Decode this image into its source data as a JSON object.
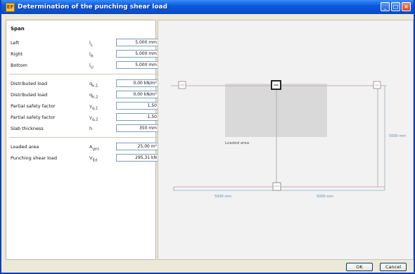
{
  "window": {
    "title": "Determination of the punching shear load",
    "app_icon": "EF"
  },
  "win_buttons": {
    "minimize": "_",
    "maximize": "□",
    "close": "×"
  },
  "span": {
    "title": "Span",
    "rows": [
      {
        "label": "Left",
        "symbol": "l",
        "sub": "L",
        "value": "5.000 mm"
      },
      {
        "label": "Right",
        "symbol": "l",
        "sub": "R",
        "value": "5.000 mm"
      },
      {
        "label": "Bottom",
        "symbol": "l",
        "sub": "U",
        "value": "5.000 mm"
      }
    ]
  },
  "loads": {
    "rows": [
      {
        "label": "Distributed load",
        "symbol": "q",
        "sub": "k,1",
        "value": "0,00 kN/m²"
      },
      {
        "label": "Distributed load",
        "symbol": "q",
        "sub": "k,2",
        "value": "0,00 kN/m²"
      },
      {
        "label": "Partial safety factor",
        "symbol": "γ",
        "sub": "q,1",
        "value": "1,50"
      },
      {
        "label": "Partial safety factor",
        "symbol": "γ",
        "sub": "q,2",
        "value": "1,50"
      },
      {
        "label": "Slab thickness",
        "symbol": "h",
        "sub": "",
        "value": "350 mm"
      }
    ]
  },
  "results": {
    "rows": [
      {
        "label": "Loaded area",
        "symbol": "A",
        "sub": "ges",
        "value": "25,00 m²"
      },
      {
        "label": "Punching shear load",
        "symbol": "V",
        "sub": "Ed",
        "value": "295,31 kN"
      }
    ]
  },
  "drawing": {
    "loaded_area_label": "Loaded area",
    "dim_left": "5000 mm",
    "dim_right": "5000 mm",
    "dim_bottom": "5000 mm"
  },
  "buttons": {
    "ok": "OK",
    "cancel": "Cancel"
  }
}
